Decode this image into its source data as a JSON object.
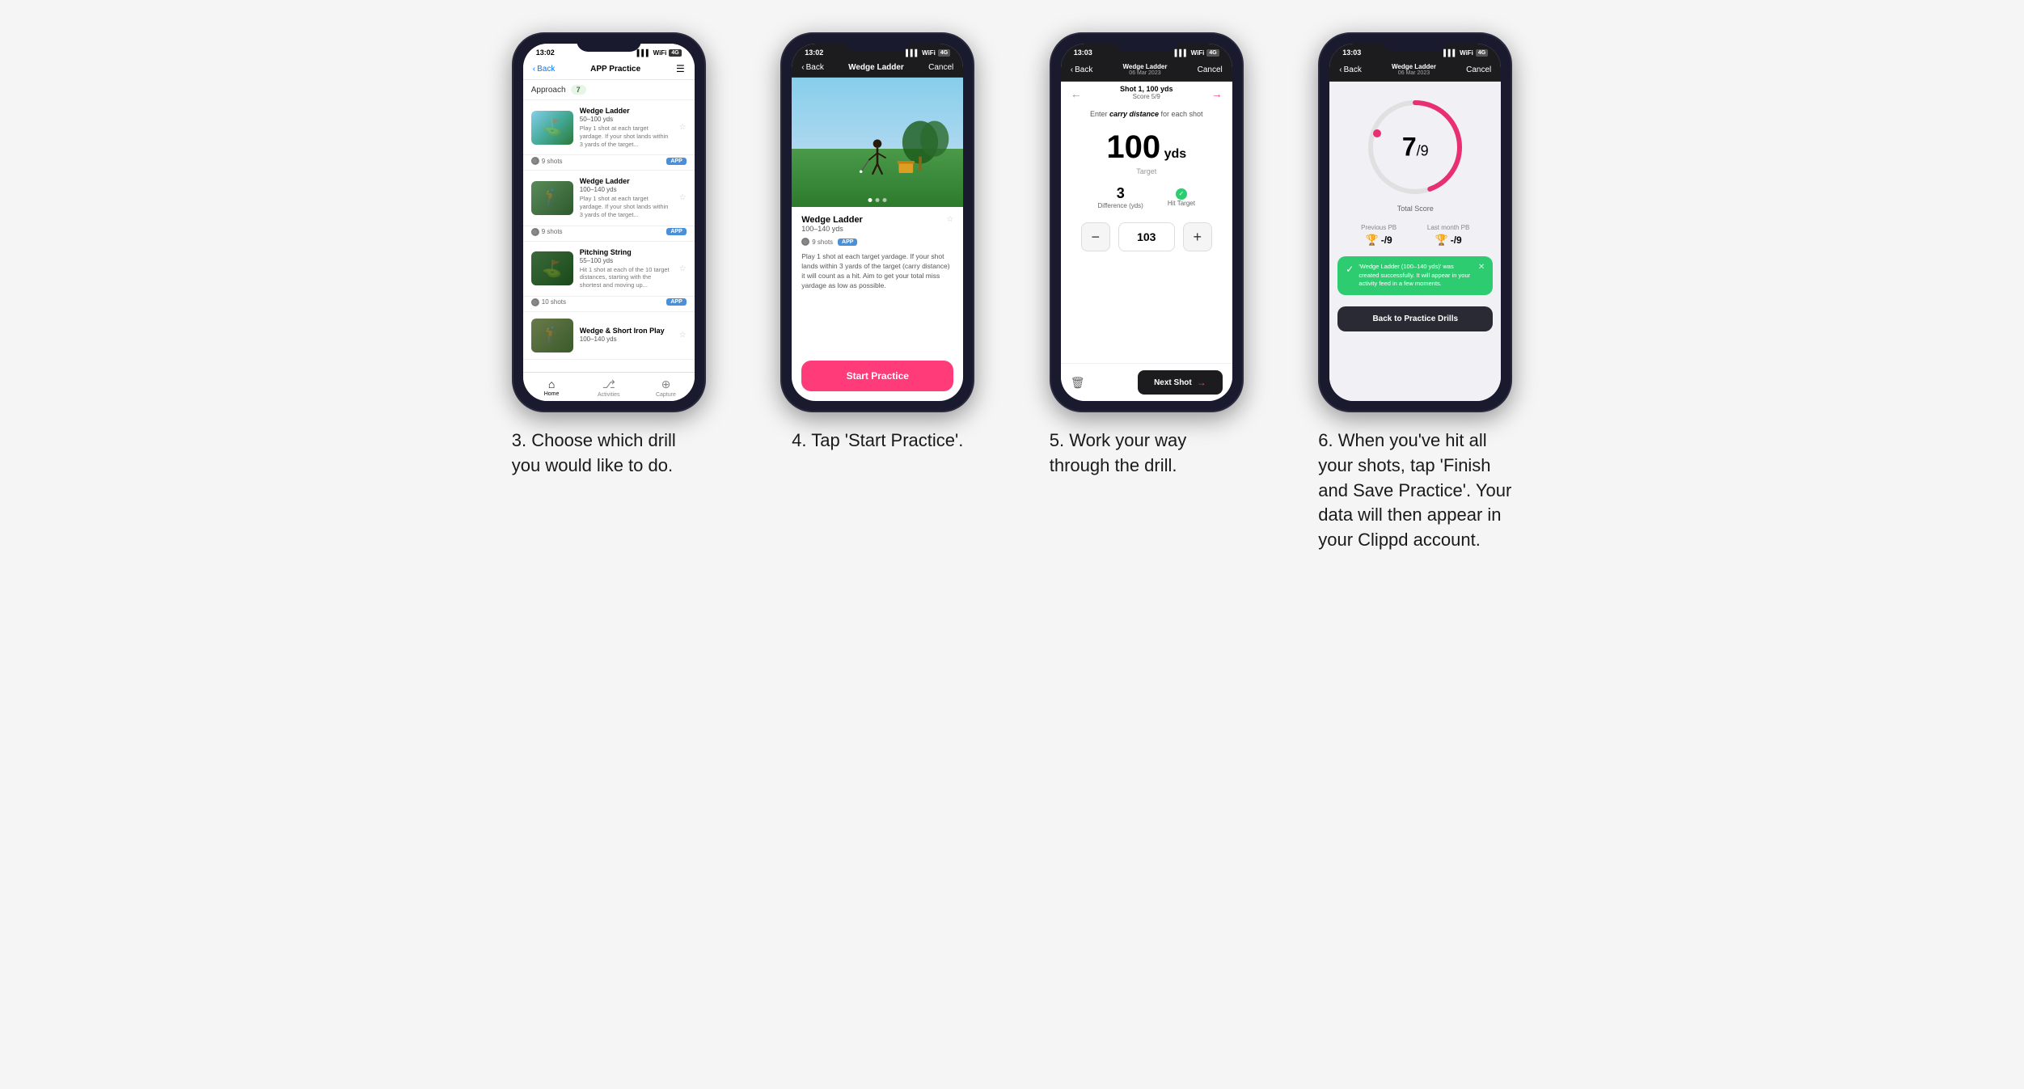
{
  "page": {
    "background": "#f5f5f5"
  },
  "sections": [
    {
      "id": "phone1",
      "caption": "3. Choose which drill you would like to do.",
      "phone": {
        "status_time": "13:02",
        "nav": {
          "back": "Back",
          "title": "APP Practice",
          "menu": "☰"
        },
        "filter": {
          "label": "Approach",
          "count": "7"
        },
        "drills": [
          {
            "name": "Wedge Ladder",
            "yds": "50–100 yds",
            "desc": "Play 1 shot at each target yardage. If your shot lands within 3 yards of the target...",
            "shots": "9 shots",
            "badge": "APP"
          },
          {
            "name": "Wedge Ladder",
            "yds": "100–140 yds",
            "desc": "Play 1 shot at each target yardage. If your shot lands within 3 yards of the target...",
            "shots": "9 shots",
            "badge": "APP"
          },
          {
            "name": "Pitching String",
            "yds": "55–100 yds",
            "desc": "Hit 1 shot at each of the 10 target distances, starting with the shortest and moving up...",
            "shots": "10 shots",
            "badge": "APP"
          },
          {
            "name": "Wedge & Short Iron Play",
            "yds": "100–140 yds",
            "desc": "",
            "shots": "",
            "badge": ""
          }
        ],
        "bottom_nav": [
          {
            "label": "Home",
            "icon": "⌂",
            "active": true
          },
          {
            "label": "Activities",
            "icon": "⎇",
            "active": false
          },
          {
            "label": "Capture",
            "icon": "⊕",
            "active": false
          }
        ]
      }
    },
    {
      "id": "phone2",
      "caption": "4. Tap 'Start Practice'.",
      "phone": {
        "status_time": "13:02",
        "nav": {
          "back": "Back",
          "title": "Wedge Ladder",
          "cancel": "Cancel"
        },
        "drill": {
          "name": "Wedge Ladder",
          "yds": "100–140 yds",
          "shots": "9 shots",
          "badge": "APP",
          "desc": "Play 1 shot at each target yardage. If your shot lands within 3 yards of the target (carry distance) it will count as a hit. Aim to get your total miss yardage as low as possible."
        },
        "start_btn": "Start Practice"
      }
    },
    {
      "id": "phone3",
      "caption": "5. Work your way through the drill.",
      "phone": {
        "status_time": "13:03",
        "nav": {
          "back": "Back",
          "title": "Wedge Ladder",
          "subtitle": "06 Mar 2023",
          "cancel": "Cancel"
        },
        "shot_label": "Shot 1, 100 yds",
        "score_label": "Score 5/9",
        "carry_prompt": "Enter carry distance for each shot",
        "target_yds": "100",
        "target_unit": "yds",
        "target_label": "Target",
        "difference": "3",
        "difference_label": "Difference (yds)",
        "hit_target_label": "Hit Target",
        "input_value": "103",
        "next_btn": "Next Shot",
        "trash_icon": "🗑"
      }
    },
    {
      "id": "phone4",
      "caption": "6. When you've hit all your shots, tap 'Finish and Save Practice'. Your data will then appear in your Clippd account.",
      "phone": {
        "status_time": "13:03",
        "nav": {
          "back": "Back",
          "title": "Wedge Ladder",
          "subtitle": "06 Mar 2023",
          "cancel": "Cancel"
        },
        "score": "7",
        "score_denom": "/9",
        "total_label": "Total Score",
        "previous_pb_label": "Previous PB",
        "previous_pb_val": "-/9",
        "last_month_pb_label": "Last month PB",
        "last_month_pb_val": "-/9",
        "success_msg": "'Wedge Ladder (100–140 yds)' was created successfully. It will appear in your activity feed in a few moments.",
        "back_btn": "Back to Practice Drills"
      }
    }
  ]
}
